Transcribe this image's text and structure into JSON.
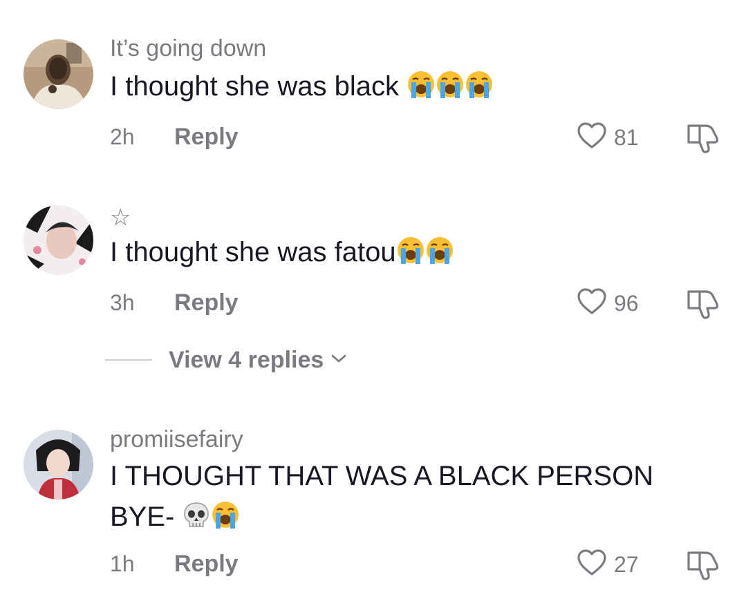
{
  "comments": [
    {
      "username": "It’s going down",
      "text": "I thought she was black",
      "time": "2h",
      "reply_label": "Reply",
      "likes": "81",
      "emojis": [
        "loudly-crying-face",
        "loudly-crying-face",
        "loudly-crying-face"
      ]
    },
    {
      "username": "☆",
      "text": "I thought she was fatou",
      "time": "3h",
      "reply_label": "Reply",
      "likes": "96",
      "emojis": [
        "loudly-crying-face",
        "loudly-crying-face"
      ],
      "view_replies_label": "View 4 replies"
    },
    {
      "username": "promiisefairy",
      "text": "I THOUGHT THAT WAS A BLACK PERSON BYE-",
      "time": "1h",
      "reply_label": "Reply",
      "likes": "27",
      "emojis": [
        "skull",
        "loudly-crying-face"
      ]
    }
  ],
  "colors": {
    "text_primary": "#161823",
    "text_secondary": "#7a7b80",
    "emoji_yellow": "#fbbf33",
    "tears_blue": "#4aa6e8"
  }
}
